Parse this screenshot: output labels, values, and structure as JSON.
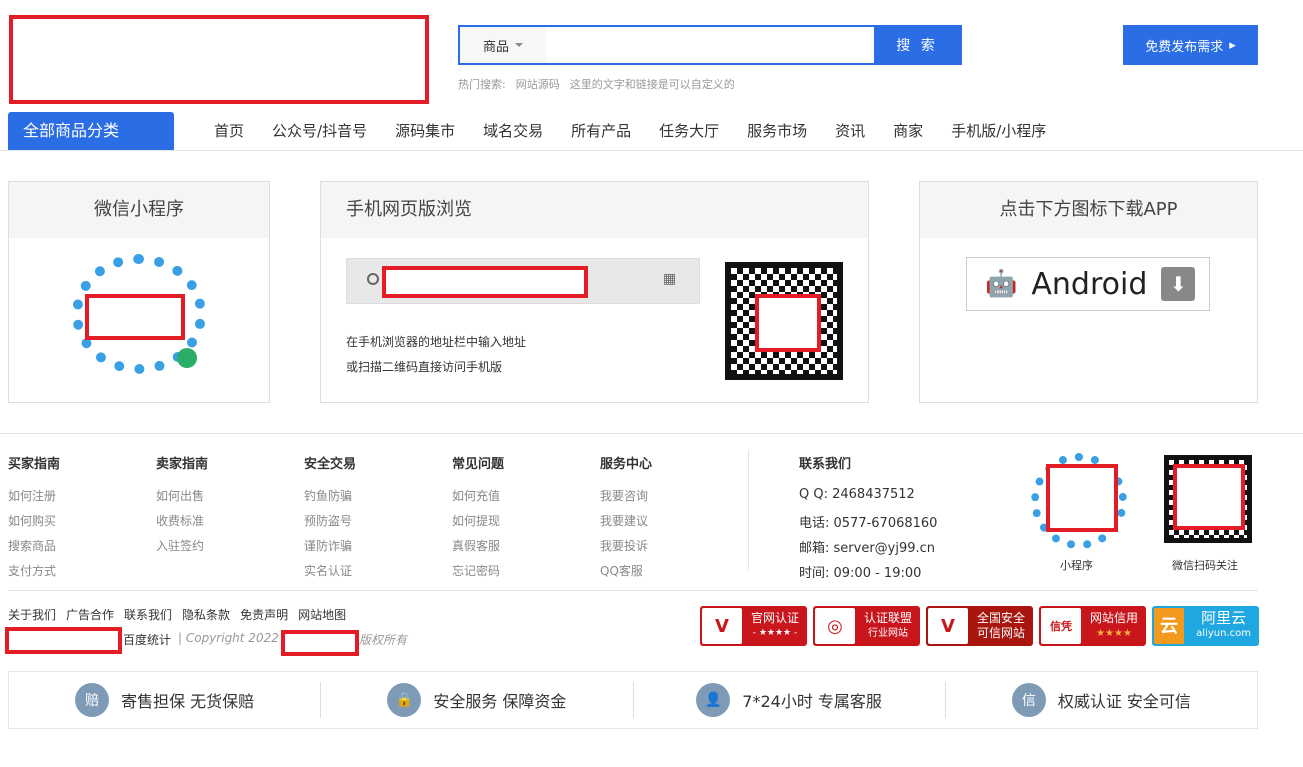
{
  "header": {
    "search_category": "商品",
    "search_button": "搜 索",
    "search_value": "",
    "publish_button": "免费发布需求",
    "hot_label": "热门搜索:",
    "hot_links": [
      "网站源码",
      "这里的文字和链接是可以自定义的"
    ]
  },
  "nav": {
    "all_categories": "全部商品分类",
    "items": [
      "首页",
      "公众号/抖音号",
      "源码集市",
      "域名交易",
      "所有产品",
      "任务大厅",
      "服务市场",
      "资讯",
      "商家",
      "手机版/小程序"
    ]
  },
  "panels": {
    "mini_program": "微信小程序",
    "mobile": "手机网页版浏览",
    "mobile_desc": [
      "在手机浏览器的地址栏中输入地址",
      "或扫描二维码直接访问手机版"
    ],
    "app": "点击下方图标下载APP",
    "android": "Android"
  },
  "footer": {
    "columns": [
      {
        "title": "买家指南",
        "links": [
          "如何注册",
          "如何购买",
          "搜索商品",
          "支付方式"
        ]
      },
      {
        "title": "卖家指南",
        "links": [
          "如何出售",
          "收费标准",
          "入驻签约"
        ]
      },
      {
        "title": "安全交易",
        "links": [
          "钓鱼防骗",
          "预防盗号",
          "谨防诈骗",
          "实名认证"
        ]
      },
      {
        "title": "常见问题",
        "links": [
          "如何充值",
          "如何提现",
          "真假客服",
          "忘记密码"
        ]
      },
      {
        "title": "服务中心",
        "links": [
          "我要咨询",
          "我要建议",
          "我要投诉",
          "QQ客服"
        ]
      }
    ],
    "contact": {
      "title": "联系我们",
      "qq": "Q Q:  2468437512",
      "phone": "电话:  0577-67068160",
      "email": "邮箱:  server@yj99.cn",
      "hours": "时间:  09:00 - 19:00"
    },
    "qr_labels": [
      "小程序",
      "微信扫码关注"
    ],
    "bottom_links": [
      "关于我们",
      "广告合作",
      "联系我们",
      "隐私条款",
      "免责声明",
      "网站地图"
    ],
    "stats": "百度统计",
    "copyright": "| Copyright 2022",
    "rights": "版权所有",
    "badges": [
      {
        "line1": "官网认证",
        "line2": "- ★★★★ -"
      },
      {
        "line1": "认证联盟",
        "line2": "行业网站"
      },
      {
        "line1": "全国安全",
        "line2": "可信网站"
      },
      {
        "line1": "网站信用",
        "line2": "★★★★"
      },
      {
        "line1": "阿里云",
        "line2": "aliyun.com"
      }
    ],
    "services": [
      {
        "icon": "赔",
        "text": "寄售担保  无货保赔"
      },
      {
        "icon": "🔒",
        "text": "安全服务  保障资金"
      },
      {
        "icon": "👤",
        "text": "7*24小时  专属客服"
      },
      {
        "icon": "信",
        "text": "权威认证  安全可信"
      }
    ]
  },
  "colors": {
    "brand": "#2b6de5",
    "badge_red": "#c9161d",
    "aliyun": "#1fa7e2"
  }
}
